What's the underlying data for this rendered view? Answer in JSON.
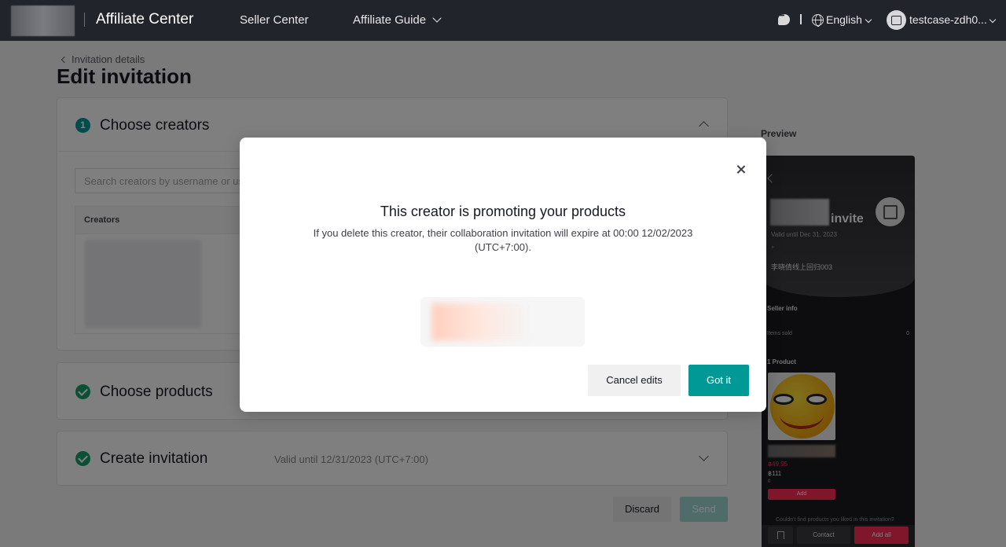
{
  "topbar": {
    "brand": "Affiliate Center",
    "nav": [
      "Seller Center",
      "Affiliate Guide"
    ],
    "language": "English",
    "user": "testcase-zdh0..."
  },
  "page": {
    "back_label": "Invitation details",
    "title": "Edit invitation"
  },
  "steps": [
    {
      "number": "1",
      "title": "Choose creators"
    },
    {
      "title": "Choose products"
    },
    {
      "title": "Create invitation",
      "meta": "Valid until 12/31/2023 (UTC+7:00)"
    }
  ],
  "creators_section": {
    "search_placeholder": "Search creators by username or user",
    "column_header": "Creators"
  },
  "actions": {
    "discard": "Discard",
    "send": "Send"
  },
  "preview": {
    "label": "Preview",
    "invite_text": "invite",
    "valid_until": "Valid until Dec 31, 2023",
    "quote_mark": "\"",
    "seller_name": "李晓倩线上回归003",
    "seller_info": "Seller info",
    "items_sold_label": "Items sold",
    "items_sold_value": "0",
    "product_count": "1 Product",
    "price": "฿49.95",
    "product_name": "฿111",
    "product_sub": "0",
    "add": "Add",
    "footer_note": "Couldn't find products you liked in this invitation?",
    "contact": "Contact",
    "add_all": "Add all"
  },
  "modal": {
    "title": "This creator is promoting your products",
    "description": "If you delete this creator, their collaboration invitation will expire at 00:00 12/02/2023 (UTC+7:00).",
    "cancel": "Cancel edits",
    "confirm": "Got it"
  },
  "colors": {
    "accent": "#009995",
    "success": "#13a06a",
    "topbar": "#22242b",
    "tiktok_red": "#fe2c55"
  }
}
